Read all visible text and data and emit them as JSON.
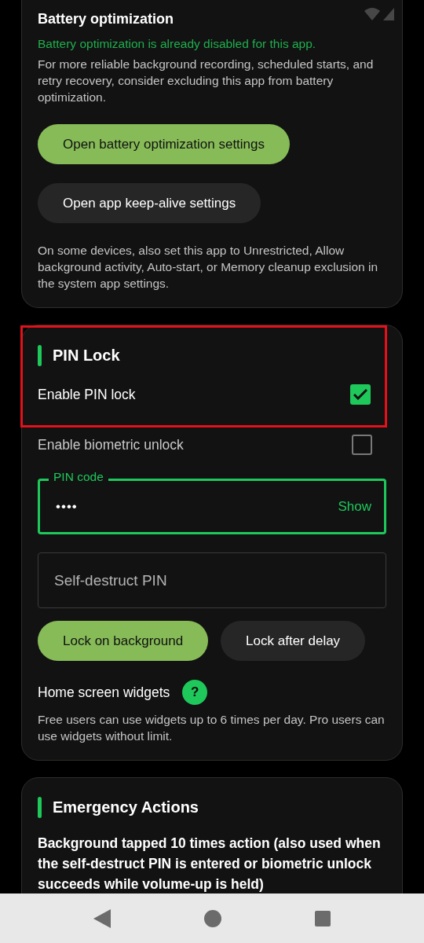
{
  "battery_section": {
    "title": "Battery optimization",
    "status": "Battery optimization is already disabled for this app.",
    "description": "For more reliable background recording, scheduled starts, and retry recovery, consider excluding this app from battery optimization.",
    "buttons": [
      {
        "label": "Open battery optimization settings",
        "kind": "primary"
      },
      {
        "label": "Open app keep-alive settings",
        "kind": "secondary"
      }
    ],
    "note": "On some devices, also set this app to Unrestricted, Allow background activity, Auto-start, or Memory cleanup exclusion in the system app settings."
  },
  "pin_section": {
    "title": "PIN Lock",
    "highlighted": true,
    "options": [
      {
        "label": "Enable PIN lock",
        "checked": true,
        "disabled": false
      },
      {
        "label": "Enable biometric unlock",
        "checked": false,
        "disabled": true
      }
    ],
    "pin_field": {
      "label": "PIN code",
      "value": "••••",
      "action": "Show",
      "focused": true
    },
    "self_destruct_field": {
      "placeholder": "Self-destruct PIN"
    },
    "lock_modes": [
      {
        "label": "Lock on background",
        "selected": true
      },
      {
        "label": "Lock after delay",
        "selected": false
      }
    ],
    "widgets_title": "Home screen widgets",
    "widgets_help": "?",
    "widgets_note": "Free users can use widgets up to 6 times per day. Pro users can use widgets without limit."
  },
  "emergency_section": {
    "title": "Emergency Actions",
    "subtitle": "Background tapped 10 times action (also used when the self-destruct PIN is entered or biometric unlock succeeds while volume-up is held)"
  }
}
